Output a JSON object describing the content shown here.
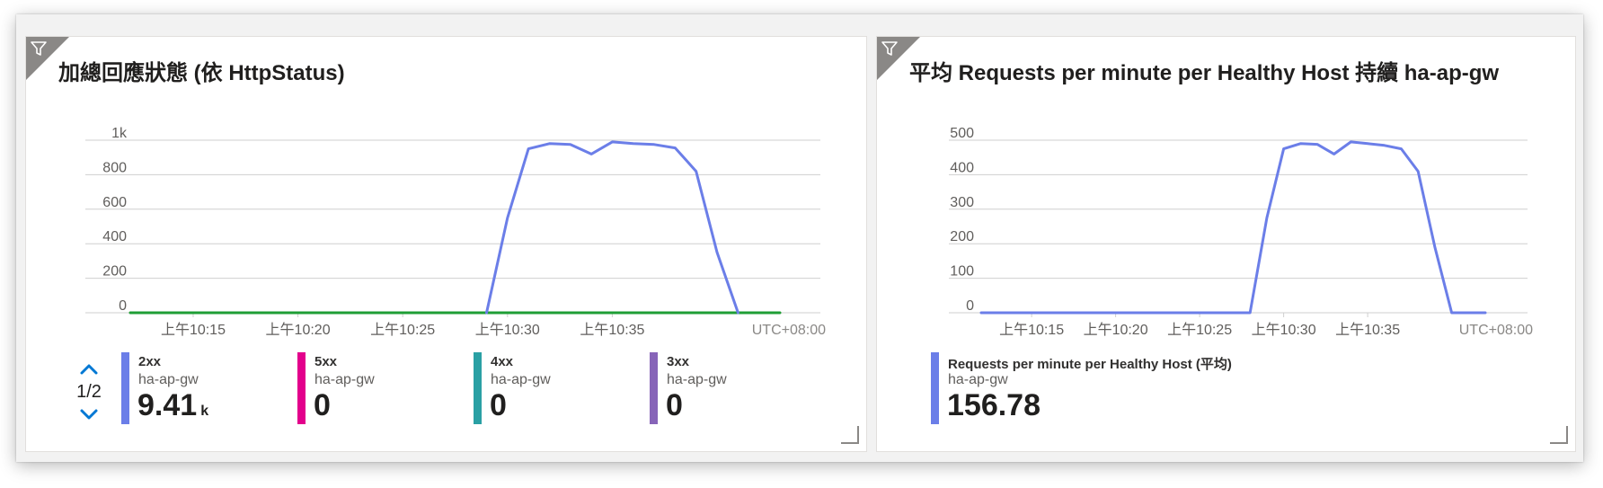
{
  "colors": {
    "series_blue": "#6b7ee8",
    "series_green": "#1f9e35",
    "legend_2xx": "#6b7ee8",
    "legend_5xx": "#e3008c",
    "legend_4xx": "#2aa0a4",
    "legend_3xx": "#8764b8",
    "grid": "#cfcfcf",
    "corner": "#8a8886"
  },
  "icons": {
    "filter": "filter-icon",
    "pager_up": "chevron-up-icon",
    "pager_down": "chevron-down-icon",
    "resize": "resize-grip-icon"
  },
  "tiles": {
    "left": {
      "title": "加總回應狀態 (依 HttpStatus)",
      "pager": "1/2",
      "legend": [
        {
          "name": "2xx",
          "resource": "ha-ap-gw",
          "value": "9.41",
          "unit": "k"
        },
        {
          "name": "5xx",
          "resource": "ha-ap-gw",
          "value": "0",
          "unit": ""
        },
        {
          "name": "4xx",
          "resource": "ha-ap-gw",
          "value": "0",
          "unit": ""
        },
        {
          "name": "3xx",
          "resource": "ha-ap-gw",
          "value": "0",
          "unit": ""
        }
      ]
    },
    "right": {
      "title": "平均 Requests per minute per Healthy Host 持續 ha-ap-gw",
      "legend": [
        {
          "name": "Requests per minute per Healthy Host (平均)",
          "resource": "ha-ap-gw",
          "value": "156.78"
        }
      ]
    }
  },
  "chart_data": [
    {
      "type": "line",
      "title": "加總回應狀態 (依 HttpStatus)",
      "x_ticks": [
        "上午10:15",
        "上午10:20",
        "上午10:25",
        "上午10:30",
        "上午10:35"
      ],
      "x_tick_minutes": [
        15,
        20,
        25,
        30,
        35
      ],
      "timezone": "UTC+08:00",
      "y_ticks": [
        "0",
        "200",
        "400",
        "600",
        "800",
        "1k"
      ],
      "y_tick_values": [
        0,
        200,
        400,
        600,
        800,
        1000
      ],
      "ylim": [
        0,
        1000
      ],
      "xlim_minutes": [
        12,
        43
      ],
      "grid": true,
      "series": [
        {
          "name": "2xx",
          "color": "#6b7ee8",
          "x": [
            29,
            30,
            31,
            32,
            33,
            34,
            35,
            36,
            37,
            38,
            39,
            40,
            41
          ],
          "y": [
            0,
            550,
            950,
            980,
            975,
            920,
            990,
            980,
            975,
            955,
            820,
            350,
            0
          ]
        },
        {
          "name": "5xx",
          "color": "#1f9e35",
          "x": [
            12,
            43
          ],
          "y": [
            0,
            0
          ]
        }
      ]
    },
    {
      "type": "line",
      "title": "平均 Requests per minute per Healthy Host 持續 ha-ap-gw",
      "x_ticks": [
        "上午10:15",
        "上午10:20",
        "上午10:25",
        "上午10:30",
        "上午10:35"
      ],
      "x_tick_minutes": [
        15,
        20,
        25,
        30,
        35
      ],
      "timezone": "UTC+08:00",
      "y_ticks": [
        "0",
        "100",
        "200",
        "300",
        "400",
        "500"
      ],
      "y_tick_values": [
        0,
        100,
        200,
        300,
        400,
        500
      ],
      "ylim": [
        0,
        500
      ],
      "xlim_minutes": [
        12,
        42
      ],
      "grid": true,
      "series": [
        {
          "name": "Requests per minute per Healthy Host (平均)",
          "color": "#6b7ee8",
          "x": [
            12,
            28,
            29,
            30,
            31,
            32,
            33,
            34,
            35,
            36,
            37,
            38,
            39,
            40,
            41,
            42
          ],
          "y": [
            0,
            0,
            275,
            475,
            490,
            488,
            460,
            495,
            490,
            485,
            475,
            410,
            190,
            0,
            0,
            0
          ]
        }
      ]
    }
  ]
}
